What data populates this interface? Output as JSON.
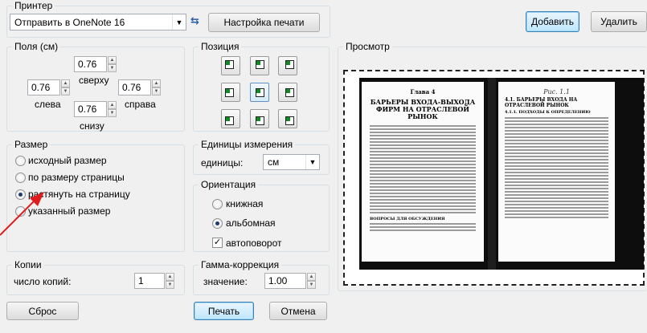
{
  "printer": {
    "group_title": "Принтер",
    "selected": "Отправить в OneNote 16",
    "settings_button": "Настройка печати"
  },
  "buttons": {
    "add": "Добавить",
    "remove": "Удалить",
    "reset": "Сброс",
    "print": "Печать",
    "cancel": "Отмена"
  },
  "margins": {
    "group_title": "Поля (см)",
    "top": {
      "label": "сверху",
      "value": "0.76"
    },
    "left": {
      "label": "слева",
      "value": "0.76"
    },
    "right": {
      "label": "справа",
      "value": "0.76"
    },
    "bottom": {
      "label": "снизу",
      "value": "0.76"
    }
  },
  "position": {
    "group_title": "Позиция",
    "selected": "center"
  },
  "preview": {
    "group_title": "Просмотр",
    "left_page": {
      "chapter": "Глава 4",
      "title": "БАРЬЕРЫ ВХОДА-ВЫХОДА ФИРМ НА ОТРАСЛЕВОЙ РЫНОК",
      "section": "ВОПРОСЫ ДЛЯ ОБСУЖДЕНИЯ"
    },
    "right_page": {
      "handwriting": "Рис. 1.1",
      "title": "4.1. БАРЬЕРЫ ВХОДА НА ОТРАСЛЕВОЙ РЫНОК",
      "subtitle": "4.1.1. ПОДХОДЫ К ОПРЕДЕЛЕНИЮ"
    }
  },
  "size": {
    "group_title": "Размер",
    "options": [
      {
        "label": "исходный размер",
        "checked": false
      },
      {
        "label": "по размеру страницы",
        "checked": false
      },
      {
        "label": "растянуть на страницу",
        "checked": true
      },
      {
        "label": "указанный размер",
        "checked": false
      }
    ]
  },
  "units": {
    "group_title": "Единицы измерения",
    "label": "единицы:",
    "value": "см"
  },
  "orientation": {
    "group_title": "Ориентация",
    "portrait": "книжная",
    "landscape": "альбомная",
    "selected": "landscape",
    "autorotate": "автоповорот",
    "autorotate_checked": true
  },
  "copies": {
    "group_title": "Копии",
    "label": "число копий:",
    "value": "1"
  },
  "gamma": {
    "group_title": "Гамма-коррекция",
    "label": "значение:",
    "value": "1.00"
  },
  "colors": {
    "annotation_arrow": "#e11b1b",
    "position_marker": "#118a24"
  }
}
